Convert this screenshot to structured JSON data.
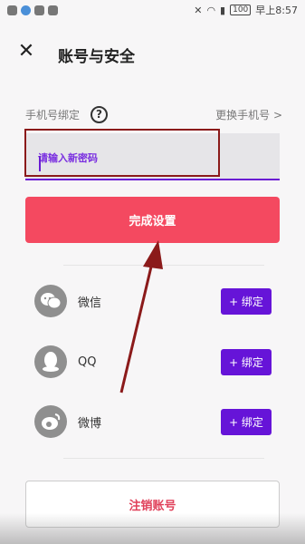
{
  "status": {
    "battery": "100",
    "time": "早上8:57"
  },
  "header": {
    "close_glyph": "✕",
    "title": "账号与安全"
  },
  "phone_bind": {
    "label": "手机号绑定",
    "help_glyph": "?",
    "change_label": "更换手机号 >"
  },
  "password": {
    "placeholder": "请输入新密码",
    "value": ""
  },
  "complete_button": "完成设置",
  "social": [
    {
      "name": "微信",
      "icon": "wechat-icon",
      "bind_label": "+ 绑定"
    },
    {
      "name": "QQ",
      "icon": "qq-icon",
      "bind_label": "+ 绑定"
    },
    {
      "name": "微博",
      "icon": "weibo-icon",
      "bind_label": "+ 绑定"
    }
  ],
  "logout_button": "注销账号",
  "colors": {
    "accent_purple": "#6614d8",
    "primary_red": "#f44960",
    "annotation": "#8b1a1a"
  }
}
